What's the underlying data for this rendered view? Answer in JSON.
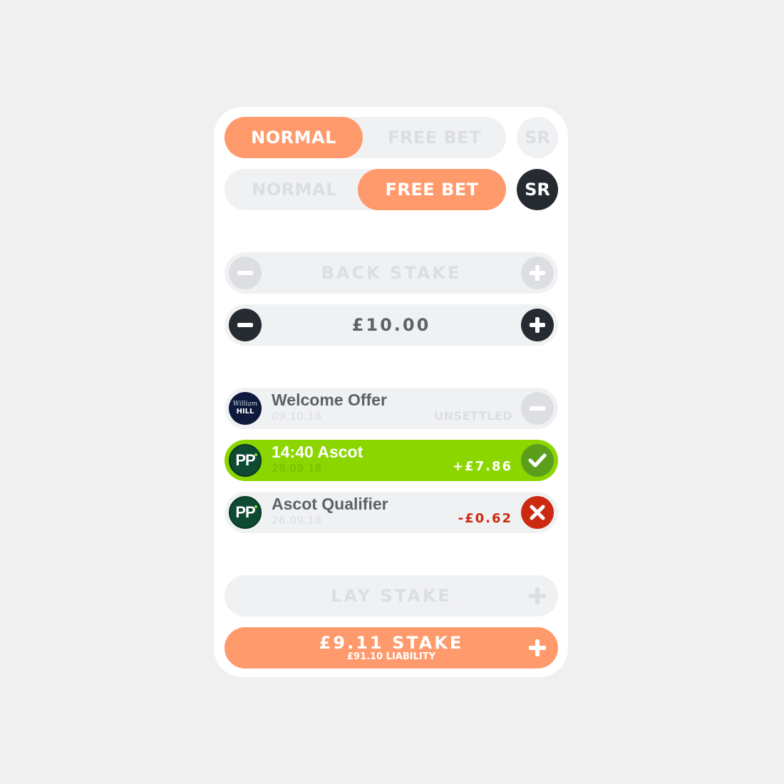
{
  "toggle_normal": {
    "normal_label": "NORMAL",
    "freebet_label": "FREE BET",
    "sr_label": "SR",
    "active": "normal"
  },
  "toggle_freebet": {
    "normal_label": "NORMAL",
    "freebet_label": "FREE BET",
    "sr_label": "SR",
    "active": "free bet"
  },
  "back_stake": {
    "placeholder_label": "BACK STAKE",
    "value": "£10.00"
  },
  "bets": [
    {
      "title": "Welcome Offer",
      "date": "09.10.18",
      "result": "UNSETTLED",
      "bookmaker": "William Hill",
      "logo_top": "William",
      "logo_bottom": "HILL",
      "status": "pending"
    },
    {
      "title": "14:40 Ascot",
      "date": "28.09.18",
      "result": "+£7.86",
      "bookmaker": "Paddy Power",
      "logo_text": "PP",
      "status": "won"
    },
    {
      "title": "Ascot Qualifier",
      "date": "26.09.18",
      "result": "-£0.62",
      "bookmaker": "Paddy Power",
      "logo_text": "PP",
      "status": "lost"
    }
  ],
  "lay_stake": {
    "placeholder_label": "LAY STAKE",
    "stake_label": "£9.11 STAKE",
    "liability_label": "£91.10 LIABILITY"
  },
  "colors": {
    "accent": "#ff9a6c",
    "win": "#8cd600",
    "loss": "#cc2a10",
    "dark": "#262b31"
  }
}
